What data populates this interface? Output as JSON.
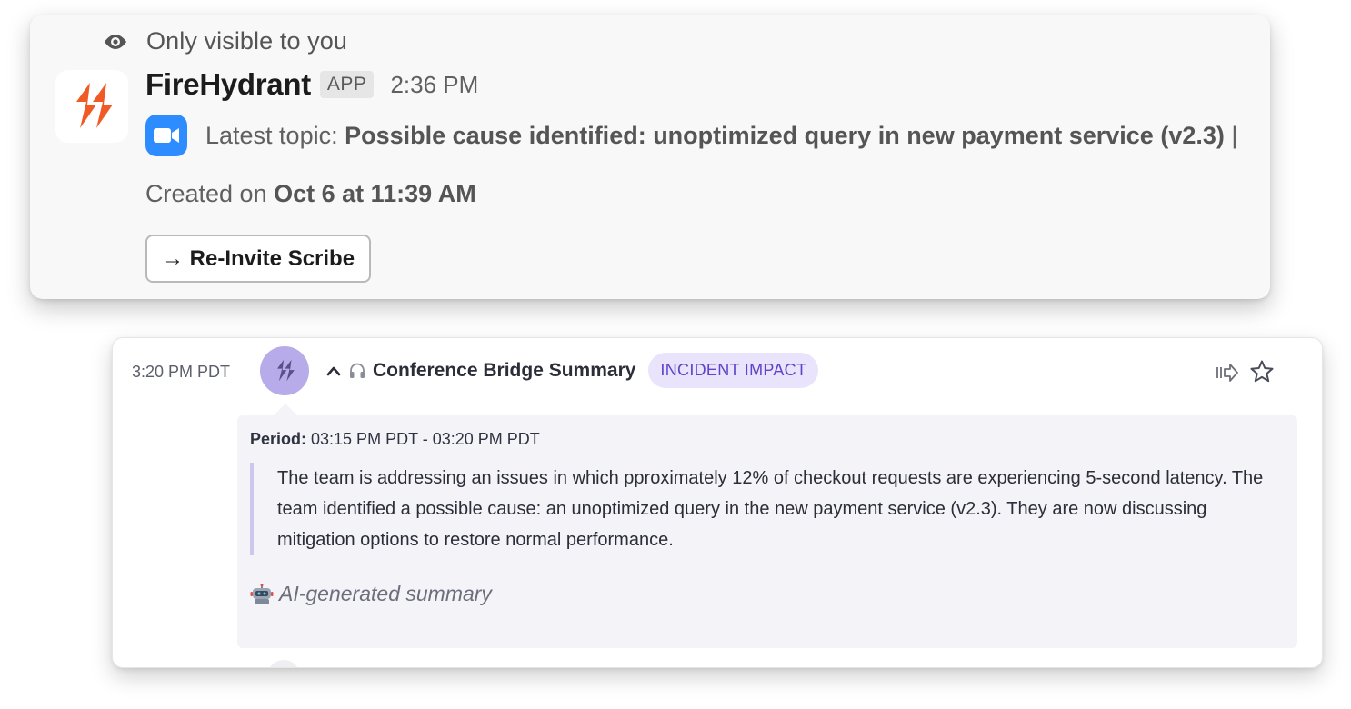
{
  "slack_message": {
    "ephemeral_label": "Only visible to you",
    "sender_name": "FireHydrant",
    "app_badge": "APP",
    "timestamp": "2:36 PM",
    "topic_prefix": "Latest topic: ",
    "topic_bold": "Possible cause identified: unoptimized query in new payment service (v2.3)",
    "topic_suffix": " |",
    "created_prefix": "Created on ",
    "created_bold": "Oct 6 at 11:39 AM",
    "button_label": "→ Re-Invite Scribe",
    "brand_color": "#f15a24",
    "zoom_color": "#2d8cff"
  },
  "timeline_entry": {
    "time": "3:20 PM PDT",
    "title": "Conference Bridge Summary",
    "badge": "INCIDENT IMPACT",
    "period_label": "Period:",
    "period_value": " 03:15 PM PDT - 03:20 PM PDT",
    "summary": "The team is addressing an issues in which pproximately 12% of checkout requests are experiencing 5-second latency. The team identified a possible cause: an unoptimized query in the new payment service (v2.3). They are now discussing mitigation options to restore normal performance.",
    "ai_label": "AI-generated summary",
    "accent_color": "#5f43c9",
    "avatar_color": "#b8abea"
  },
  "icons": {
    "ephemeral": "eye-icon",
    "app_logo": "firehydrant-logo-icon",
    "meeting": "zoom-video-icon",
    "collapse": "chevron-up-icon",
    "audio": "headphones-icon",
    "forward": "forward-icon",
    "favorite": "star-icon",
    "ai": "robot-icon"
  }
}
